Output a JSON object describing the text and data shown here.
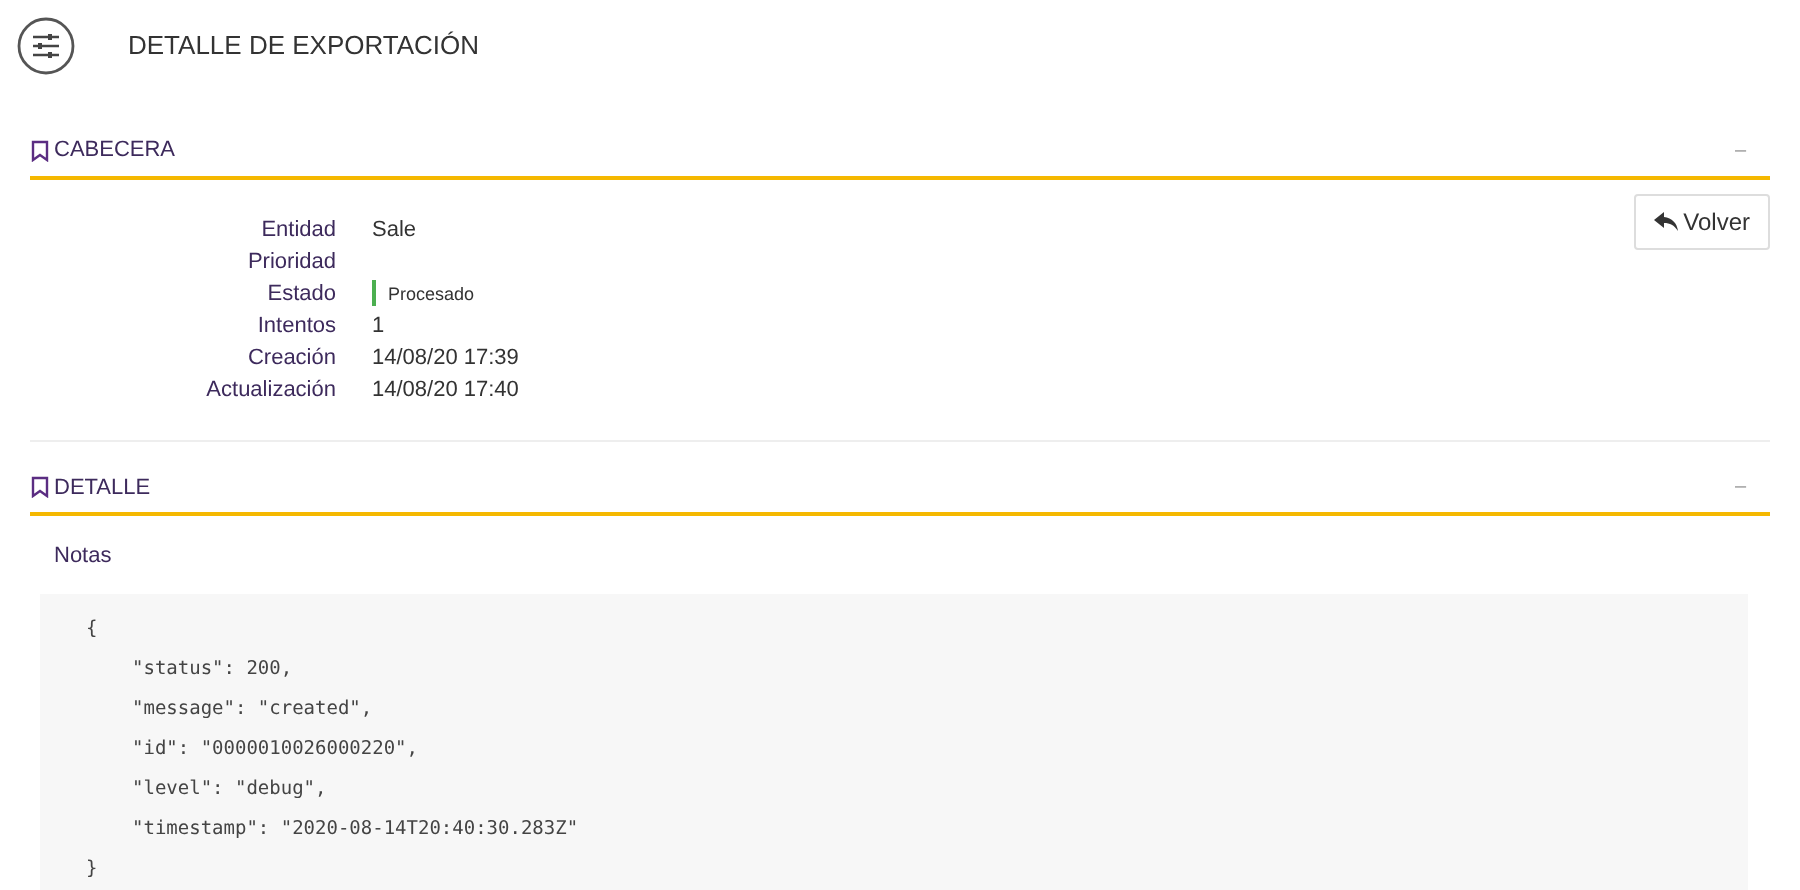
{
  "page_title": "DETALLE DE EXPORTACIÓN",
  "header_section": {
    "title": "CABECERA",
    "collapse": "–",
    "fields": [
      {
        "label": "Entidad",
        "value": "Sale",
        "kind": "text"
      },
      {
        "label": "Prioridad",
        "kind": "text"
      },
      {
        "label": "Estado",
        "value": "Procesado",
        "kind": "status",
        "color": "#4caf50"
      },
      {
        "label": "Intentos",
        "value": "1",
        "kind": "text"
      },
      {
        "label": "Creación",
        "value": "14/08/20 17:39",
        "kind": "text"
      },
      {
        "label": "Actualización",
        "value": "14/08/20 17:40",
        "kind": "text"
      }
    ],
    "back_button": "Volver"
  },
  "detail_section": {
    "title": "DETALLE",
    "collapse": "–",
    "notes_label": "Notas",
    "code": {
      "open": "{",
      "lines": [
        "\"status\": 200,",
        "\"message\": \"created\",",
        "\"id\": \"0000010026000220\",",
        "\"level\": \"debug\",",
        "\"timestamp\": \"2020-08-14T20:40:30.283Z\""
      ],
      "close": "}"
    }
  }
}
